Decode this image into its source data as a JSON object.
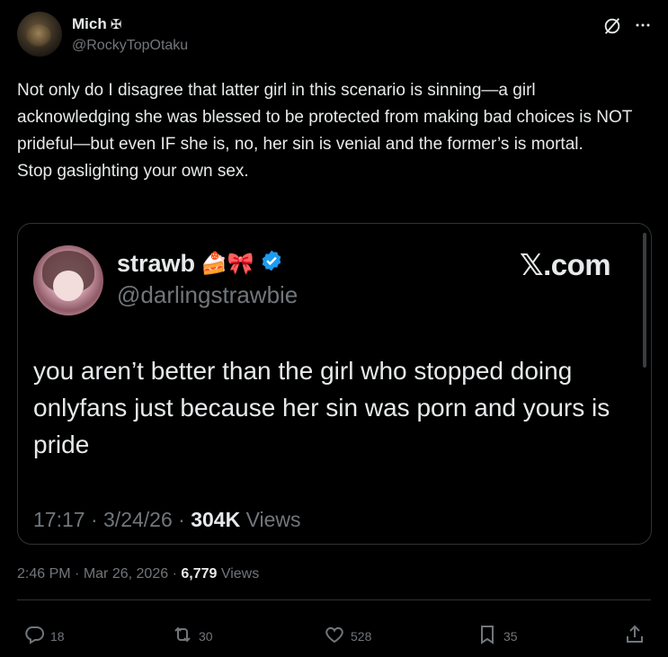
{
  "author": {
    "name": "Mich",
    "name_badge": "✠",
    "handle": "@RockyTopOtaku"
  },
  "tweet": {
    "paragraphs": [
      "Not only do I disagree that latter girl in this scenario is sinning—a girl acknowledging she was blessed to be protected from making bad choices is NOT prideful—but even IF she is, no, her sin is venial and the former’s is mortal.",
      "Stop gaslighting your own sex."
    ]
  },
  "quote": {
    "name": "strawb",
    "emojis": "🍰🎀",
    "handle": "@darlingstrawbie",
    "source": "𝕏.com",
    "text": "you aren’t better than the girl who stopped doing onlyfans just because her sin was porn and yours is pride",
    "time": "17:17",
    "date": "3/24/26",
    "views_count": "304K",
    "views_label": "Views"
  },
  "meta": {
    "time": "2:46 PM",
    "date": "Mar 26, 2026",
    "views_count": "6,779",
    "views_label": "Views",
    "separator": "·"
  },
  "actions": {
    "replies": "18",
    "reposts": "30",
    "likes": "528",
    "bookmarks": "35"
  },
  "colors": {
    "background": "#000000",
    "text": "#e7e9ea",
    "muted": "#71767b",
    "border": "#2f3336",
    "verified": "#1d9bf0"
  },
  "icons": [
    "grok-icon",
    "more-icon",
    "verified-badge-icon",
    "reply-icon",
    "retweet-icon",
    "like-icon",
    "bookmark-icon",
    "share-icon"
  ]
}
